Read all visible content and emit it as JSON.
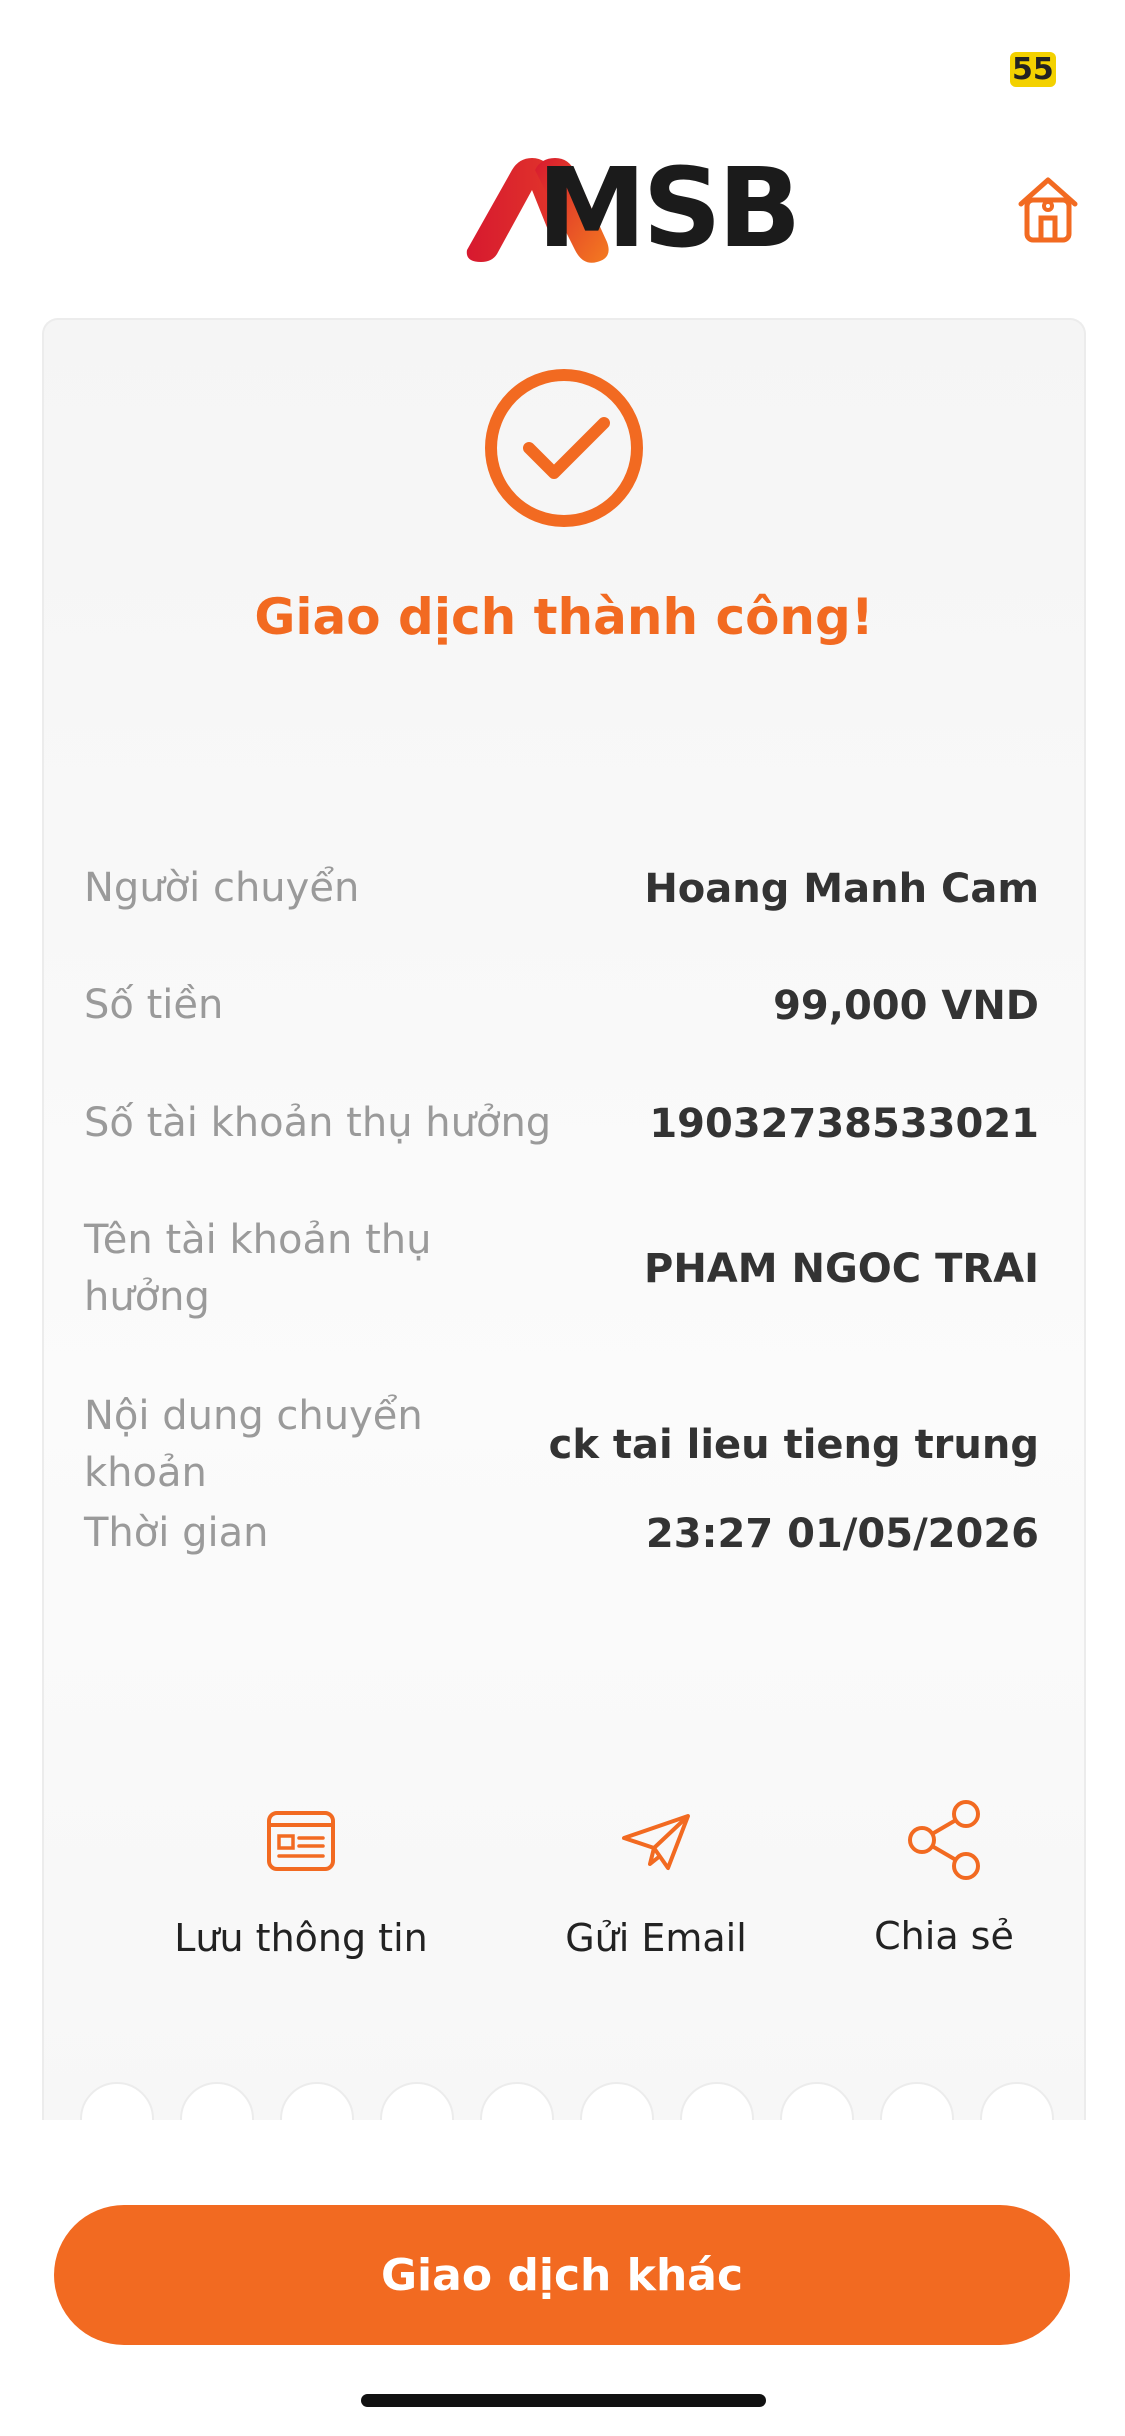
{
  "status": {
    "battery": "55"
  },
  "header": {
    "brand": "MSB"
  },
  "receipt": {
    "title": "Giao dịch thành công!",
    "rows": [
      {
        "label": "Người chuyển",
        "value": "Hoang Manh Cam"
      },
      {
        "label": "Số tiền",
        "value": "99,000 VND"
      },
      {
        "label": "Số tài khoản thụ hưởng",
        "value": "19032738533021"
      },
      {
        "label_line1": "Tên tài khoản thụ",
        "label_line2": "hưởng",
        "value": "PHAM NGOC TRAI"
      },
      {
        "label": "Nội dung chuyển khoản",
        "value": "ck tai lieu tieng trung"
      },
      {
        "label": "Thời gian",
        "value": "23:27 01/05/2026"
      }
    ],
    "actions": [
      {
        "label": "Lưu thông tin",
        "icon": "save-info-icon"
      },
      {
        "label": "Gửi Email",
        "icon": "send-email-icon"
      },
      {
        "label": "Chia sẻ",
        "icon": "share-icon"
      }
    ]
  },
  "footer": {
    "primary_button": "Giao dịch khác"
  },
  "colors": {
    "accent": "#f26a21",
    "brand_red": "#d7192f",
    "text_muted": "#9a9a9a"
  }
}
